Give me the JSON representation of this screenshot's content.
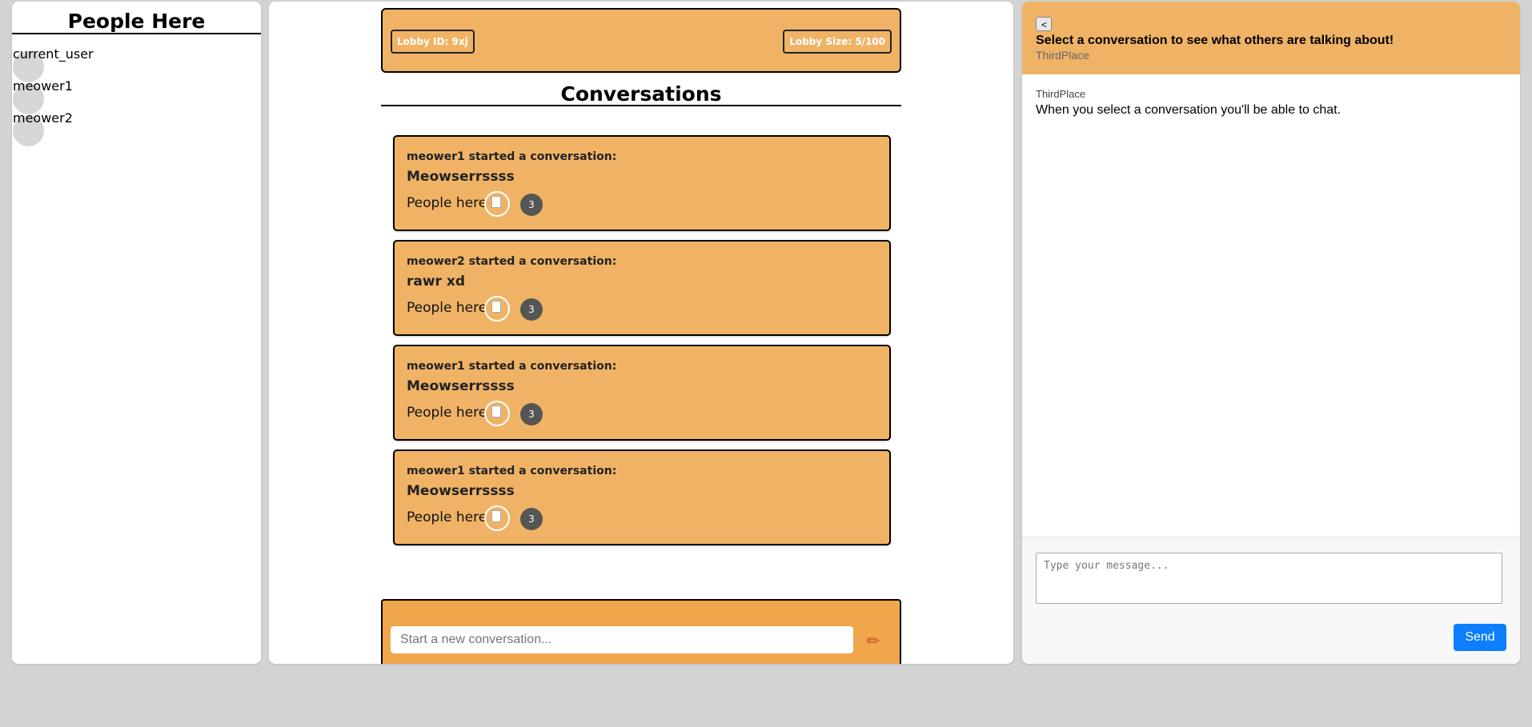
{
  "people_panel": {
    "title": "People Here",
    "users": [
      "current_user",
      "meower1",
      "meower2"
    ]
  },
  "lobby": {
    "id_label": "Lobby ID: 9xj",
    "size_label": "Lobby Size: 5/100"
  },
  "conversations_heading": "Conversations",
  "conversations": [
    {
      "starter": "meower1 started a conversation:",
      "title": "Meowserrssss",
      "people_label": "People here:",
      "count": "3"
    },
    {
      "starter": "meower2 started a conversation:",
      "title": "rawr xd",
      "people_label": "People here:",
      "count": "3"
    },
    {
      "starter": "meower1 started a conversation:",
      "title": "Meowserrssss",
      "people_label": "People here:",
      "count": "3"
    },
    {
      "starter": "meower1 started a conversation:",
      "title": "Meowserrssss",
      "people_label": "People here:",
      "count": "3"
    }
  ],
  "composer": {
    "placeholder": "Start a new conversation...",
    "button_icon": "pencil-icon"
  },
  "chat": {
    "back_label": "<",
    "prompt": "Select a conversation to see what others are talking about!",
    "app_name": "ThirdPlace",
    "message": {
      "sender": "ThirdPlace",
      "text": "When you select a conversation you'll be able to chat."
    },
    "input_placeholder": "Type your message...",
    "send_label": "Send"
  },
  "colors": {
    "accent": "#f0b366",
    "composer": "#f0a64b",
    "send": "#0d7efc",
    "background": "#d3d3d3"
  }
}
